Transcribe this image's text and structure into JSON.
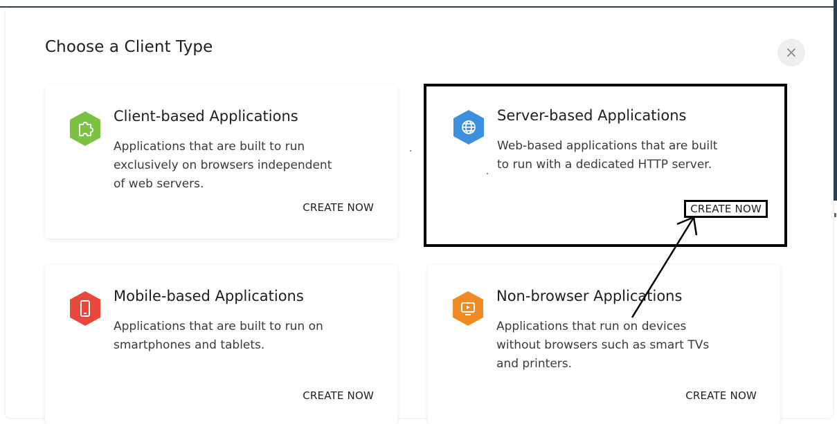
{
  "modal": {
    "title": "Choose a Client Type",
    "close_icon": "close-icon"
  },
  "cards": [
    {
      "title": "Client-based Applications",
      "description": "Applications that are built to run exclusively on browsers independent of web servers.",
      "action": "CREATE NOW",
      "icon": "puzzle-icon",
      "color": "#7cc242"
    },
    {
      "title": "Server-based Applications",
      "description": "Web-based applications that are built to run with a dedicated HTTP server.",
      "action": "CREATE NOW",
      "icon": "globe-icon",
      "color": "#3d8fe0"
    },
    {
      "title": "Mobile-based Applications",
      "description": "Applications that are built to run on smartphones and tablets.",
      "action": "CREATE NOW",
      "icon": "smartphone-icon",
      "color": "#e8473b"
    },
    {
      "title": "Non-browser Applications",
      "description": "Applications that run on devices without browsers such as smart TVs and printers.",
      "action": "CREATE NOW",
      "icon": "tv-icon",
      "color": "#f08a24"
    }
  ]
}
